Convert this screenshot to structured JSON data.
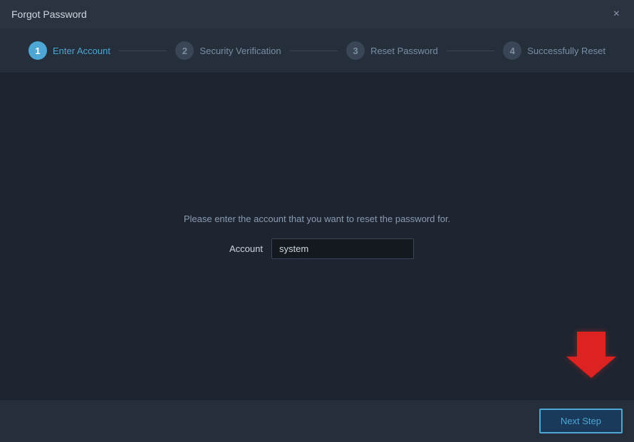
{
  "window": {
    "title": "Forgot Password",
    "close_icon": "×"
  },
  "steps": [
    {
      "number": "1",
      "label": "Enter Account",
      "state": "active"
    },
    {
      "number": "2",
      "label": "Security Verification",
      "state": "inactive"
    },
    {
      "number": "3",
      "label": "Reset Password",
      "state": "inactive"
    },
    {
      "number": "4",
      "label": "Successfully Reset",
      "state": "inactive"
    }
  ],
  "form": {
    "description": "Please enter the account that you want to reset the password for.",
    "account_label": "Account",
    "account_value": "system",
    "account_placeholder": ""
  },
  "footer": {
    "next_step_label": "Next Step"
  }
}
